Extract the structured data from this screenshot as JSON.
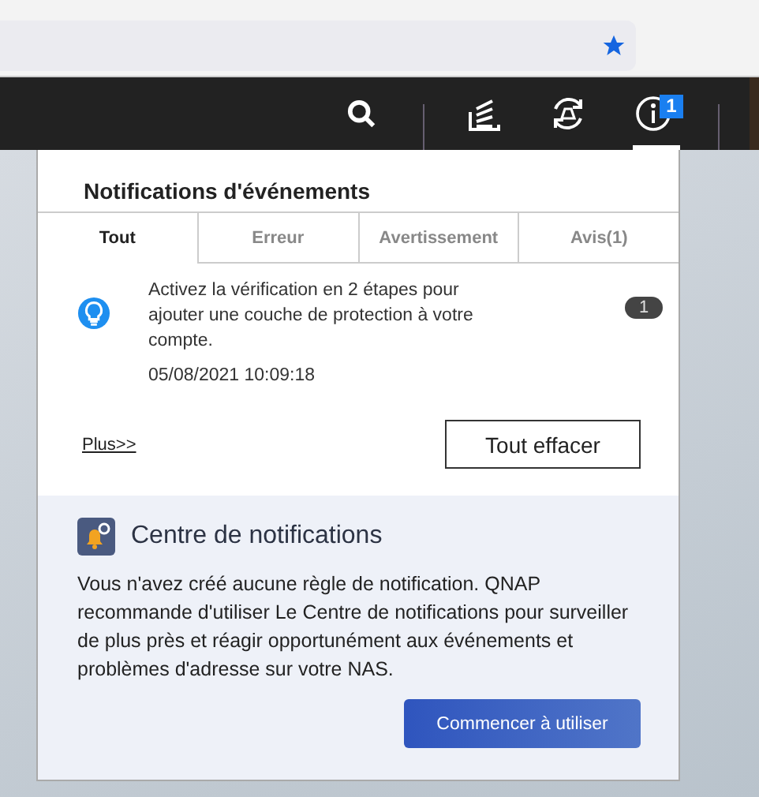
{
  "toolbar": {
    "notification_badge": "1"
  },
  "panel": {
    "title": "Notifications d'événements",
    "tabs": [
      {
        "label": "Tout",
        "selected": true
      },
      {
        "label": "Erreur",
        "selected": false
      },
      {
        "label": "Avertissement",
        "selected": false
      },
      {
        "label": "Avis(1)",
        "selected": false
      }
    ],
    "notifications": [
      {
        "message": "Activez la vérification en 2 étapes pour ajouter une couche de protection à votre compte.",
        "time": "05/08/2021 10:09:18",
        "count": "1"
      }
    ],
    "more_link": "Plus>>",
    "clear_button": "Tout effacer"
  },
  "notification_center": {
    "title": "Centre de notifications",
    "text": "Vous n'avez créé aucune règle de notification. QNAP recommande d'utiliser Le Centre de notifications pour surveiller de plus près et réagir opportunément aux événements et problèmes d'adresse sur votre NAS.",
    "button": "Commencer à utiliser"
  }
}
